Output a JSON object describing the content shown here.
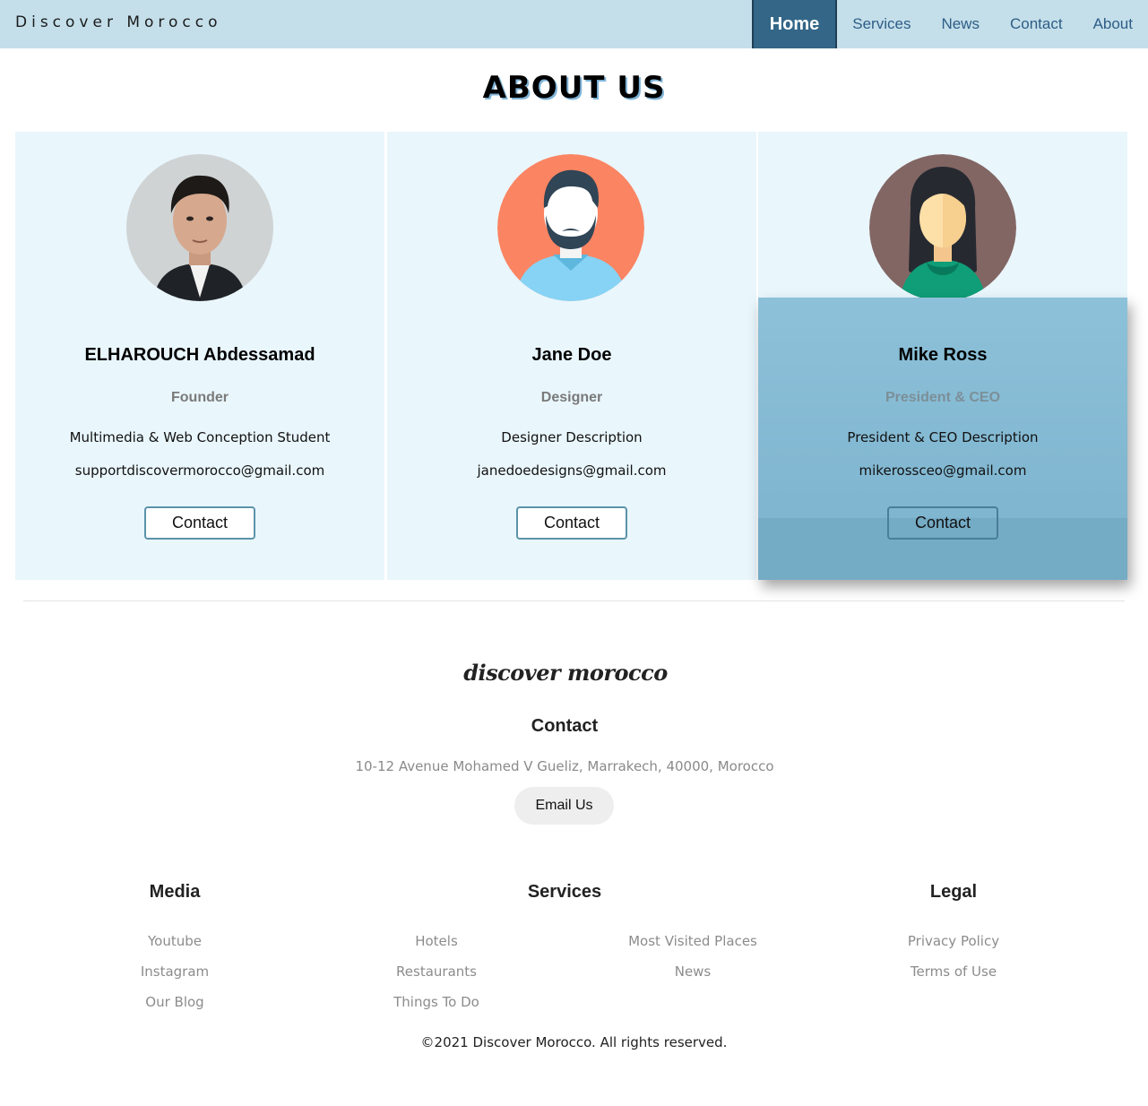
{
  "nav": {
    "brand": "Discover Morocco",
    "links": [
      {
        "label": "Home",
        "active": true
      },
      {
        "label": "Services",
        "active": false
      },
      {
        "label": "News",
        "active": false
      },
      {
        "label": "Contact",
        "active": false
      },
      {
        "label": "About",
        "active": false
      }
    ]
  },
  "page": {
    "title": "ABOUT US"
  },
  "team": [
    {
      "name": "ELHAROUCH Abdessamad",
      "role": "Founder",
      "description": "Multimedia & Web Conception Student",
      "email": "supportdiscovermorocco@gmail.com",
      "button": "Contact",
      "avatar_icon": "man-portrait-photo"
    },
    {
      "name": "Jane Doe",
      "role": "Designer",
      "description": "Designer Description",
      "email": "janedoedesigns@gmail.com",
      "button": "Contact",
      "avatar_icon": "bearded-man-avatar-icon"
    },
    {
      "name": "Mike Ross",
      "role": "President & CEO",
      "description": "President & CEO Description",
      "email": "mikerossceo@gmail.com",
      "button": "Contact",
      "avatar_icon": "woman-avatar-icon"
    }
  ],
  "footer": {
    "logo": "discover morocco",
    "contact_title": "Contact",
    "address": "10-12 Avenue Mohamed V Gueliz, Marrakech, 40000, Morocco",
    "email_button": "Email Us",
    "columns": {
      "media": {
        "title": "Media",
        "links": [
          "Youtube",
          "Instagram",
          "Our Blog"
        ]
      },
      "services": {
        "title": "Services",
        "links_left": [
          "Hotels",
          "Restaurants",
          "Things To Do"
        ],
        "links_right": [
          "Most Visited Places",
          "News"
        ]
      },
      "legal": {
        "title": "Legal",
        "links": [
          "Privacy Policy",
          "Terms of Use"
        ]
      }
    },
    "copyright": "©2021 Discover Morocco. All rights reserved."
  },
  "colors": {
    "nav_bg": "#c4dfea",
    "nav_active": "#336687",
    "card_bg": "#e9f6fc",
    "hover_card": "#8dc1d9",
    "link_text": "#2e5d86"
  }
}
